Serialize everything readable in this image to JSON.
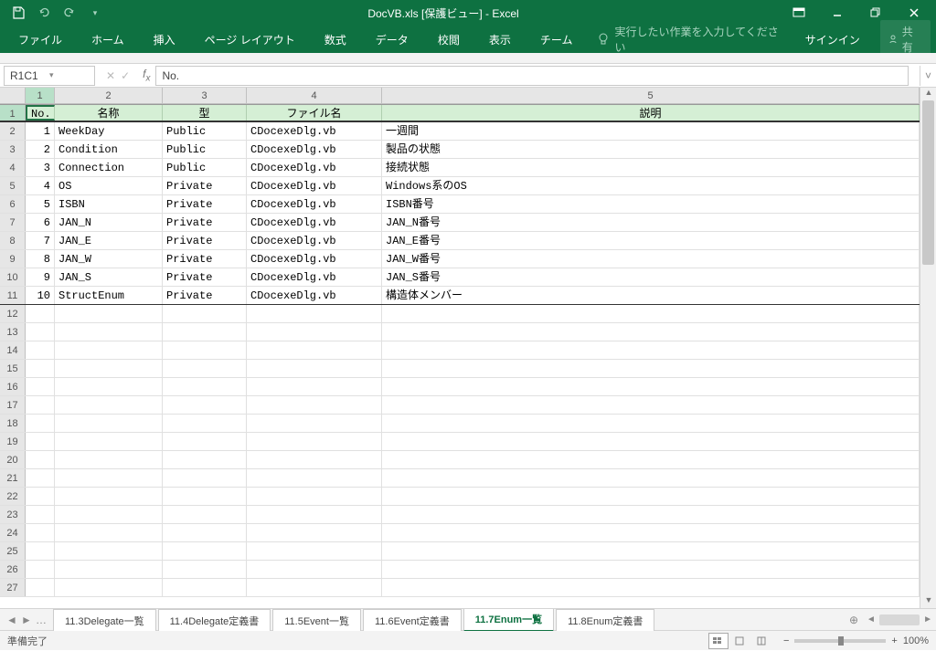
{
  "title": "DocVB.xls  [保護ビュー] - Excel",
  "qat": {
    "save": "保存"
  },
  "ribbon_tabs": [
    "ファイル",
    "ホーム",
    "挿入",
    "ページ レイアウト",
    "数式",
    "データ",
    "校閲",
    "表示",
    "チーム"
  ],
  "tellme": "実行したい作業を入力してください",
  "signin": "サインイン",
  "share": "共有",
  "namebox": "R1C1",
  "formula": "No.",
  "col_headers": [
    "1",
    "2",
    "3",
    "4",
    "5"
  ],
  "row_headers": [
    "1",
    "2",
    "3",
    "4",
    "5",
    "6",
    "7",
    "8",
    "9",
    "10",
    "11",
    "12",
    "13",
    "14",
    "15",
    "16",
    "17",
    "18",
    "19",
    "20",
    "21",
    "22",
    "23",
    "24",
    "25",
    "26",
    "27"
  ],
  "headers": {
    "no": "No.",
    "name": "名称",
    "type": "型",
    "file": "ファイル名",
    "desc": "説明"
  },
  "rows": [
    {
      "no": "1",
      "name": "WeekDay",
      "type": "Public",
      "file": "CDocexeDlg.vb",
      "desc": "一週間"
    },
    {
      "no": "2",
      "name": "Condition",
      "type": "Public",
      "file": "CDocexeDlg.vb",
      "desc": "製品の状態"
    },
    {
      "no": "3",
      "name": "Connection",
      "type": "Public",
      "file": "CDocexeDlg.vb",
      "desc": "接続状態"
    },
    {
      "no": "4",
      "name": "OS",
      "type": "Private",
      "file": "CDocexeDlg.vb",
      "desc": "Windows系のOS"
    },
    {
      "no": "5",
      "name": "ISBN",
      "type": "Private",
      "file": "CDocexeDlg.vb",
      "desc": "ISBN番号"
    },
    {
      "no": "6",
      "name": "JAN_N",
      "type": "Private",
      "file": "CDocexeDlg.vb",
      "desc": "JAN_N番号"
    },
    {
      "no": "7",
      "name": "JAN_E",
      "type": "Private",
      "file": "CDocexeDlg.vb",
      "desc": "JAN_E番号"
    },
    {
      "no": "8",
      "name": "JAN_W",
      "type": "Private",
      "file": "CDocexeDlg.vb",
      "desc": "JAN_W番号"
    },
    {
      "no": "9",
      "name": "JAN_S",
      "type": "Private",
      "file": "CDocexeDlg.vb",
      "desc": "JAN_S番号"
    },
    {
      "no": "10",
      "name": "StructEnum",
      "type": "Private",
      "file": "CDocexeDlg.vb",
      "desc": "構造体メンバー"
    }
  ],
  "sheets": [
    "11.3Delegate一覧",
    "11.4Delegate定義書",
    "11.5Event一覧",
    "11.6Event定義書",
    "11.7Enum一覧",
    "11.8Enum定義書"
  ],
  "active_sheet": 4,
  "status": "準備完了",
  "zoom": "100%"
}
